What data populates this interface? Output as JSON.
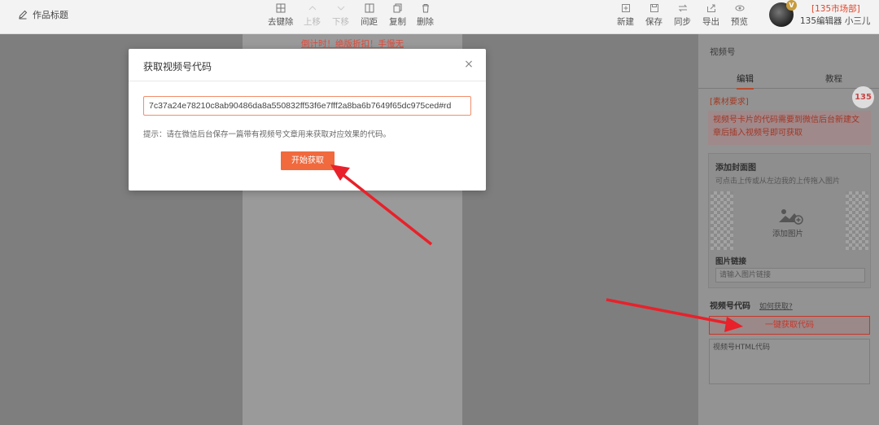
{
  "toolbar": {
    "doc_title": "作品标题",
    "tools_center": [
      {
        "label": "去键除",
        "icon": "grid-icon",
        "disabled": false
      },
      {
        "label": "上移",
        "icon": "up-icon",
        "disabled": true
      },
      {
        "label": "下移",
        "icon": "down-icon",
        "disabled": true
      },
      {
        "label": "间距",
        "icon": "spacing-icon",
        "disabled": false
      },
      {
        "label": "复制",
        "icon": "copy-icon",
        "disabled": false
      },
      {
        "label": "删除",
        "icon": "trash-icon",
        "disabled": false
      }
    ],
    "tools_right": [
      {
        "label": "新建",
        "icon": "new-icon"
      },
      {
        "label": "保存",
        "icon": "save-icon"
      },
      {
        "label": "同步",
        "icon": "sync-icon"
      },
      {
        "label": "导出",
        "icon": "export-icon"
      },
      {
        "label": "预览",
        "icon": "preview-icon"
      }
    ],
    "user_dept": "[135市场部]",
    "user_name": "135编辑器 小三儿",
    "user_badge": "V"
  },
  "canvas": {
    "promo": "倒计时！绝版折扣！手慢无"
  },
  "right_panel": {
    "title": "视频号",
    "tabs": [
      "编辑",
      "教程"
    ],
    "active_tab": "编辑",
    "section_label": "[素材要求]",
    "notice": "视频号卡片的代码需要到微信后台新建文章后插入视频号即可获取",
    "cover_title": "添加封面图",
    "cover_hint": "可点击上传或从左边我的上传拖入图片",
    "add_image": "添加图片",
    "image_link_label": "图片链接",
    "image_link_placeholder": "请输入图片链接",
    "code_label": "视频号代码",
    "howto_link": "如何获取?",
    "onekey_button": "一键获取代码",
    "code_placeholder": "视频号HTML代码",
    "logo": "135"
  },
  "modal": {
    "title": "获取视频号代码",
    "close": "×",
    "input_value": "7c37a24e78210c8ab90486da8a550832ff53f6e7fff2a8ba6b7649f65dc975ced#rd",
    "hint": "提示：请在微信后台保存一篇带有视频号文章用来获取对应效果的代码。",
    "start_button": "开始获取"
  },
  "colors": {
    "accent": "#f06a3e",
    "arrow": "#e8212a",
    "overlay": "#8d8d8d"
  }
}
